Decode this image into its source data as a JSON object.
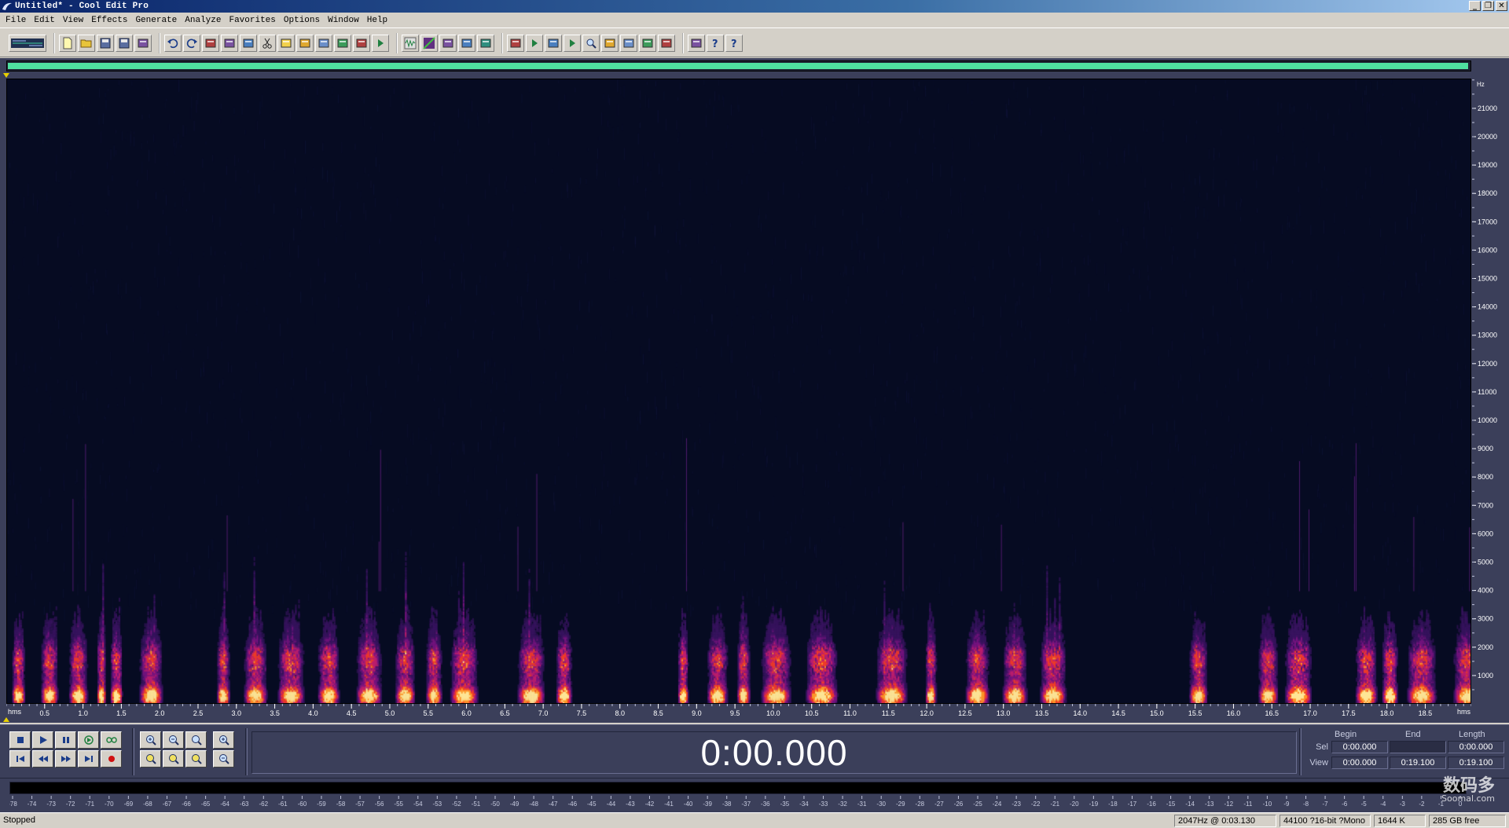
{
  "window": {
    "title": "Untitled* - Cool Edit Pro",
    "controls": [
      "_",
      "❐",
      "✕"
    ]
  },
  "menu": [
    "File",
    "Edit",
    "View",
    "Effects",
    "Generate",
    "Analyze",
    "Favorites",
    "Options",
    "Window",
    "Help"
  ],
  "toolbar": {
    "groups": [
      [
        "multitrack-toggle"
      ],
      [
        "new-file-icon",
        "open-file-icon",
        "save-icon",
        "save-all-icon",
        "close-icon"
      ],
      [
        "undo-icon",
        "redo-icon",
        "repeat-icon",
        "copy-icon",
        "copy-new-icon",
        "cut-icon",
        "paste-icon",
        "paste-new-icon",
        "mix-paste-icon",
        "crop-icon",
        "trim-icon",
        "cdplayer-icon"
      ],
      [
        "waveform-view-icon",
        "spectral-view-icon",
        "envelope-icon",
        "stretch-icon",
        "filter-icon"
      ],
      [
        "cue-list-icon",
        "play-list-icon",
        "snap-icon",
        "play-icon",
        "zoom-icon",
        "numeric-icon",
        "statistics-icon",
        "frequency-icon",
        "info-icon"
      ],
      [
        "options-icon",
        "context-help-icon",
        "help-icon"
      ]
    ]
  },
  "overview": {
    "fill_fraction": 0.999
  },
  "spectrogram": {
    "freq_axis_unit": "Hz",
    "freq_ticks": [
      "21000",
      "20000",
      "19000",
      "18000",
      "17000",
      "16000",
      "15000",
      "14000",
      "13000",
      "12000",
      "11000",
      "10000",
      "9000",
      "8000",
      "7000",
      "6000",
      "5000",
      "4000",
      "3000",
      "2000",
      "1000"
    ],
    "time_axis_unit": "hms",
    "time_ticks": [
      "0.5",
      "1.0",
      "1.5",
      "2.0",
      "2.5",
      "3.0",
      "3.5",
      "4.0",
      "4.5",
      "5.0",
      "5.5",
      "6.0",
      "6.5",
      "7.0",
      "7.5",
      "8.0",
      "8.5",
      "9.0",
      "9.5",
      "10.0",
      "10.5",
      "11.0",
      "11.5",
      "12.0",
      "12.5",
      "13.0",
      "13.5",
      "14.0",
      "14.5",
      "15.0",
      "15.5",
      "16.0",
      "16.5",
      "17.0",
      "17.5",
      "18.0",
      "18.5"
    ],
    "max_freq": 22050,
    "duration_seconds": 19.1
  },
  "transport": {
    "row1": [
      "stop-icon",
      "play-icon",
      "pause-icon",
      "play-to-end-icon",
      "loop-icon"
    ],
    "row2": [
      "go-start-icon",
      "rewind-icon",
      "fast-forward-icon",
      "go-end-icon",
      "record-icon"
    ]
  },
  "zoom": {
    "row1": [
      "zoom-in-h-icon",
      "zoom-out-h-icon",
      "zoom-full-icon",
      "zoom-in-v-icon"
    ],
    "row2": [
      "zoom-left-icon",
      "zoom-right-icon",
      "zoom-sel-icon",
      "zoom-out-v-icon"
    ]
  },
  "time_display": "0:00.000",
  "selection": {
    "headers": {
      "begin": "Begin",
      "end": "End",
      "length": "Length"
    },
    "sel_label": "Sel",
    "view_label": "View",
    "sel_begin": "0:00.000",
    "sel_end": "",
    "sel_length": "0:00.000",
    "view_begin": "0:00.000",
    "view_end": "0:19.100",
    "view_length": "0:19.100"
  },
  "level_meter": {
    "ticks": [
      "-78",
      "-74",
      "-73",
      "-72",
      "-71",
      "-70",
      "-69",
      "-68",
      "-67",
      "-66",
      "-65",
      "-64",
      "-63",
      "-62",
      "-61",
      "-60",
      "-59",
      "-58",
      "-57",
      "-56",
      "-55",
      "-54",
      "-53",
      "-52",
      "-51",
      "-50",
      "-49",
      "-48",
      "-47",
      "-46",
      "-45",
      "-44",
      "-43",
      "-42",
      "-41",
      "-40",
      "-39",
      "-38",
      "-37",
      "-36",
      "-35",
      "-34",
      "-33",
      "-32",
      "-31",
      "-30",
      "-29",
      "-28",
      "-27",
      "-26",
      "-25",
      "-24",
      "-23",
      "-22",
      "-21",
      "-20",
      "-19",
      "-18",
      "-17",
      "-16",
      "-15",
      "-14",
      "-13",
      "-12",
      "-11",
      "-10",
      "-9",
      "-8",
      "-7",
      "-6",
      "-5",
      "-4",
      "-3",
      "-2",
      "-1",
      "0"
    ]
  },
  "status": {
    "state": "Stopped",
    "cursor": "2047Hz @   0:03.130",
    "format": "44100 ?16-bit ?Mono",
    "size": "1644 K",
    "free": "285 GB free"
  },
  "watermark": {
    "main": "数码多",
    "sub": "Soomal.com"
  },
  "colors": {
    "accent_green": "#4fe0a0",
    "spectro_bg": "#060b22",
    "panel_bg": "#3b3f5a",
    "marker": "#e8d000"
  }
}
